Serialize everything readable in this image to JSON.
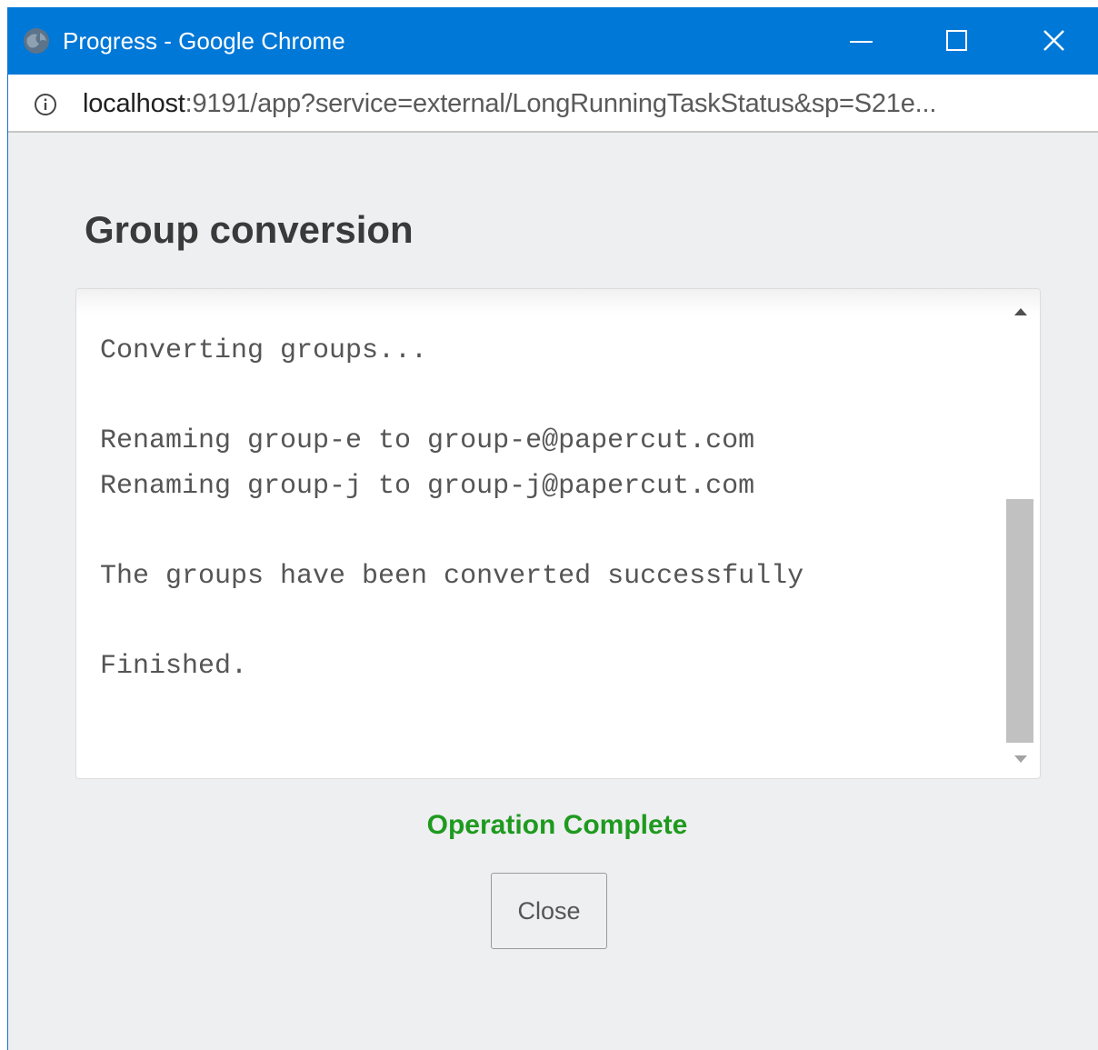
{
  "window": {
    "title": "Progress - Google Chrome",
    "title_bar_color": "#0078d7",
    "controls": {
      "minimize_icon": "minimize-icon",
      "maximize_icon": "maximize-icon",
      "close_icon": "close-icon"
    }
  },
  "addressbar": {
    "info_icon": "info-icon",
    "url_host": "localhost",
    "url_rest": ":9191/app?service=external/LongRunningTaskStatus&sp=S21e..."
  },
  "dialog": {
    "heading": "Group conversion",
    "log_lines": [
      "Converting groups...",
      "",
      "Renaming group-e to group-e@papercut.com",
      "Renaming group-j to group-j@papercut.com",
      "",
      "The groups have been converted successfully",
      "",
      "Finished."
    ],
    "status": "Operation Complete",
    "status_color": "#1e9a1e",
    "close_label": "Close"
  }
}
